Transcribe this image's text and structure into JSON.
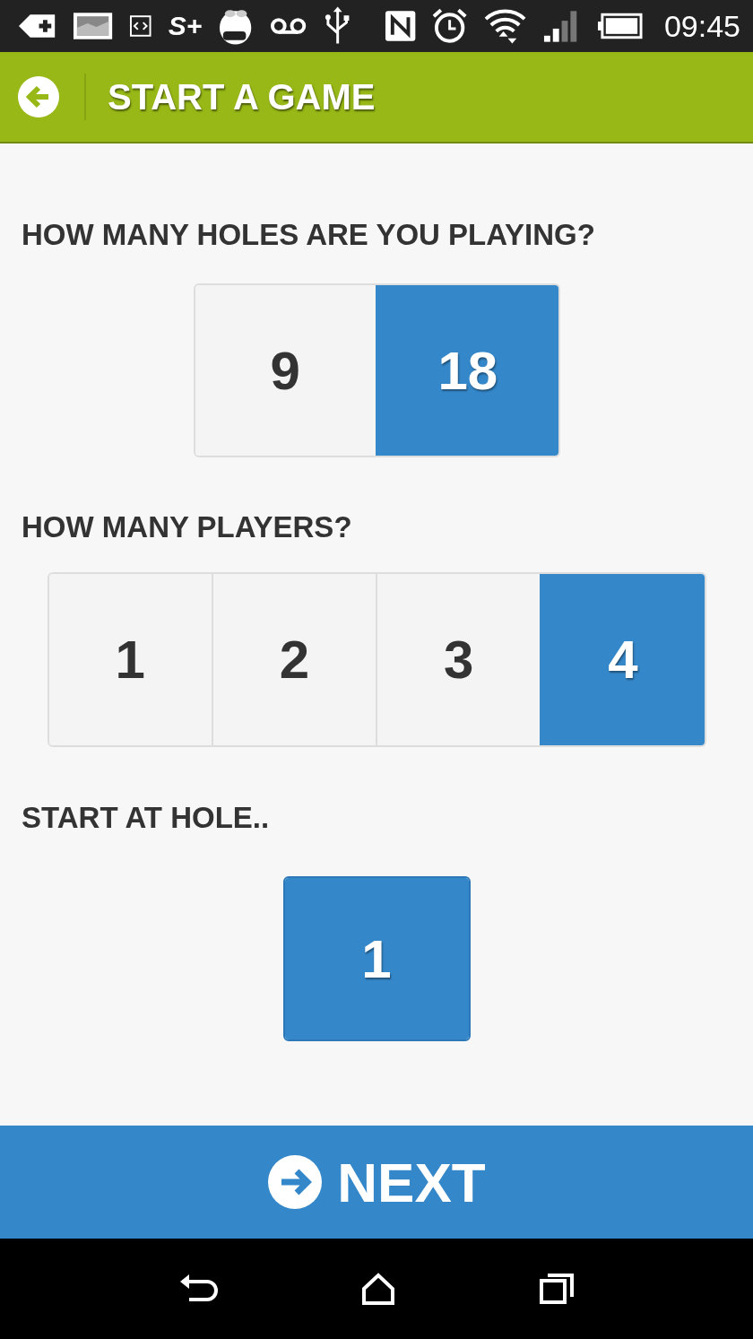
{
  "status_bar": {
    "app_badge": "S+",
    "time": "09:45"
  },
  "app_bar": {
    "title": "START A GAME"
  },
  "sections": [
    {
      "heading": "HOW MANY HOLES ARE YOU PLAYING?",
      "kind": "holes",
      "options": [
        {
          "label": "9",
          "selected": false
        },
        {
          "label": "18",
          "selected": true
        }
      ]
    },
    {
      "heading": "HOW MANY PLAYERS?",
      "kind": "players",
      "options": [
        {
          "label": "1",
          "selected": false
        },
        {
          "label": "2",
          "selected": false
        },
        {
          "label": "3",
          "selected": false
        },
        {
          "label": "4",
          "selected": true
        }
      ]
    },
    {
      "heading": "START AT HOLE..",
      "kind": "start",
      "options": [
        {
          "label": "1",
          "selected": true
        }
      ]
    }
  ],
  "next_button": {
    "label": "NEXT"
  }
}
